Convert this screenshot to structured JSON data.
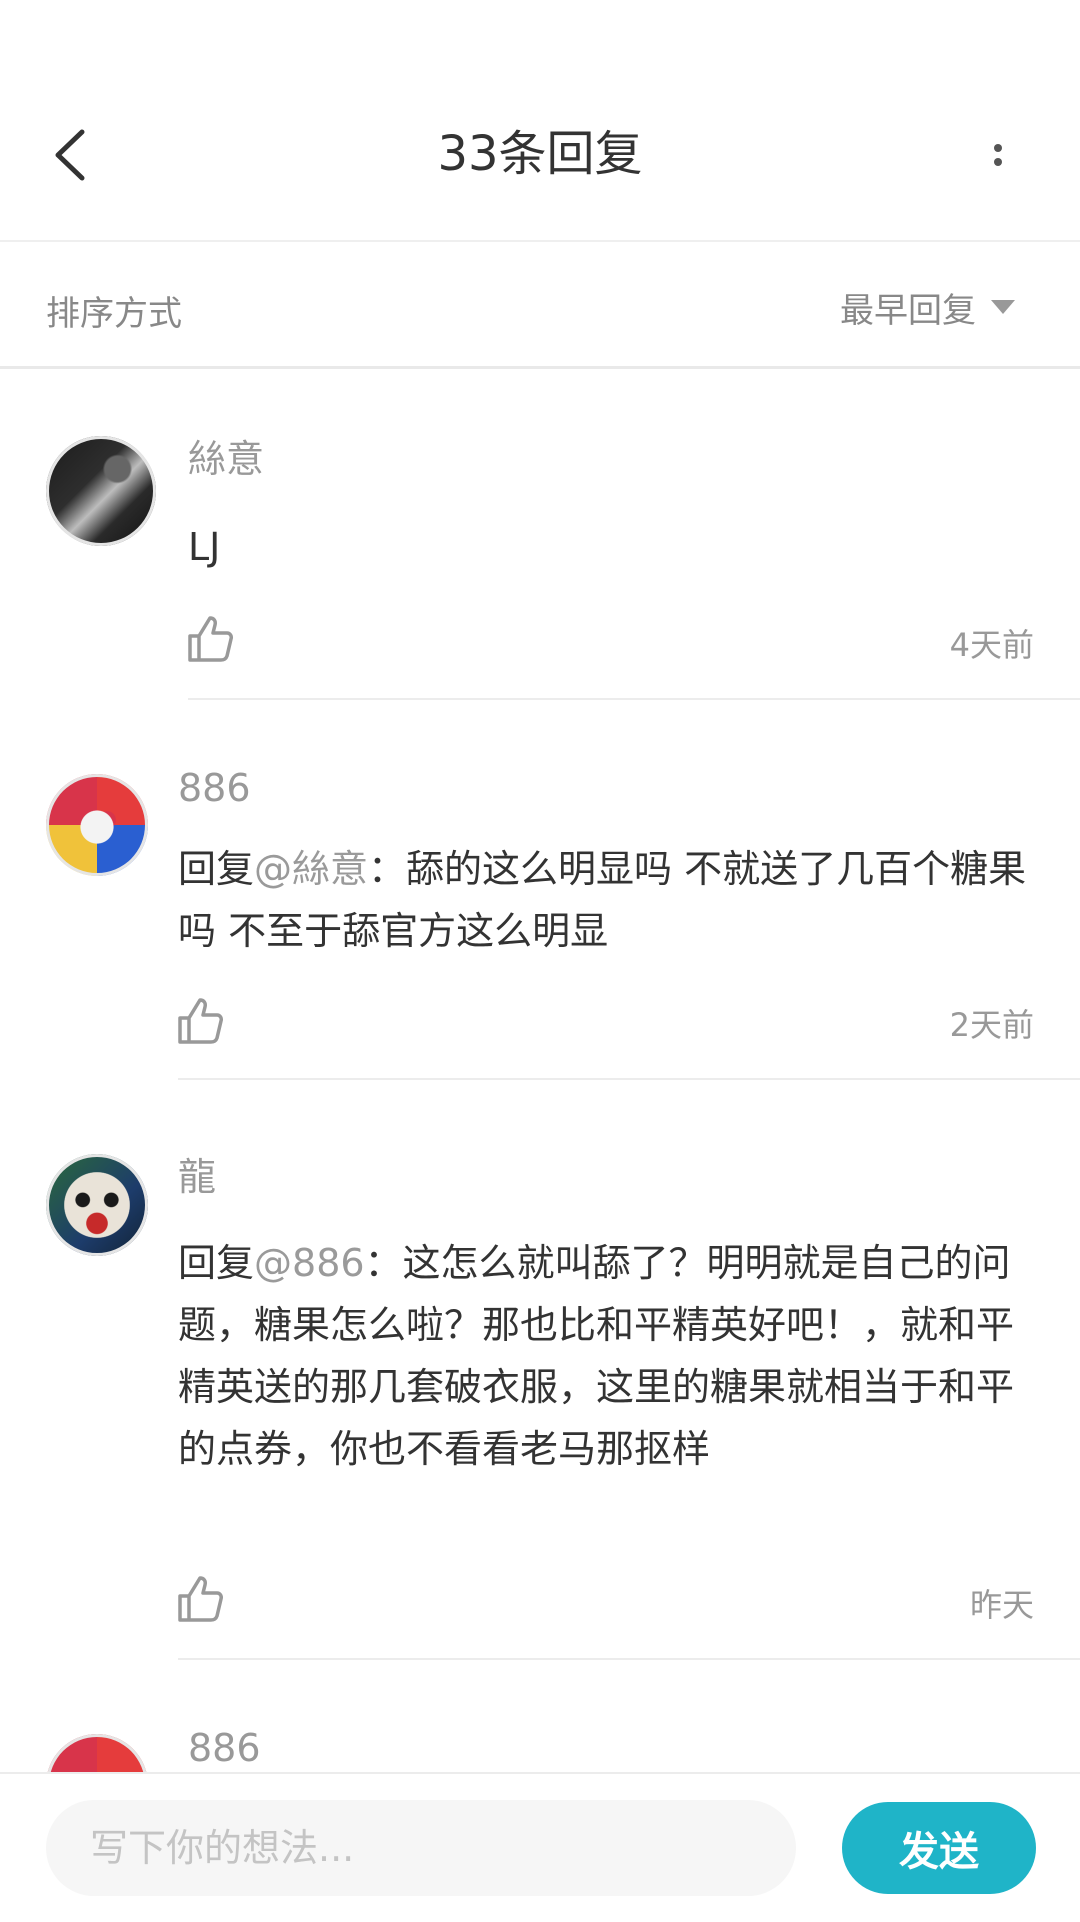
{
  "header": {
    "title": "33条回复",
    "back_icon": "chevron-left-icon",
    "more_icon": "more-vertical-icon"
  },
  "sort": {
    "label": "排序方式",
    "value": "最早回复",
    "dropdown_icon": "caret-down-icon"
  },
  "comments": [
    {
      "username": "絲意",
      "text": "LJ",
      "time": "4天前",
      "like_icon": "thumbs-up-icon"
    },
    {
      "username": "886",
      "reply_prefix": "回复",
      "mention": "@絲意",
      "text": "：舔的这么明显吗 不就送了几百个糖果吗 不至于舔官方这么明显",
      "time": "2天前",
      "like_icon": "thumbs-up-icon"
    },
    {
      "username": "龍",
      "reply_prefix": "回复",
      "mention": "@886",
      "text": "：这怎么就叫舔了？明明就是自己的问题，糖果怎么啦？那也比和平精英好吧！，就和平精英送的那几套破衣服，这里的糖果就相当于和平的点券，你也不看看老马那抠样",
      "time": "昨天",
      "like_icon": "thumbs-up-icon"
    },
    {
      "username": "886"
    }
  ],
  "composer": {
    "placeholder": "写下你的想法...",
    "send_label": "发送"
  },
  "colors": {
    "accent": "#1fb4c8",
    "muted_text": "#999999",
    "body_text": "#333333"
  }
}
